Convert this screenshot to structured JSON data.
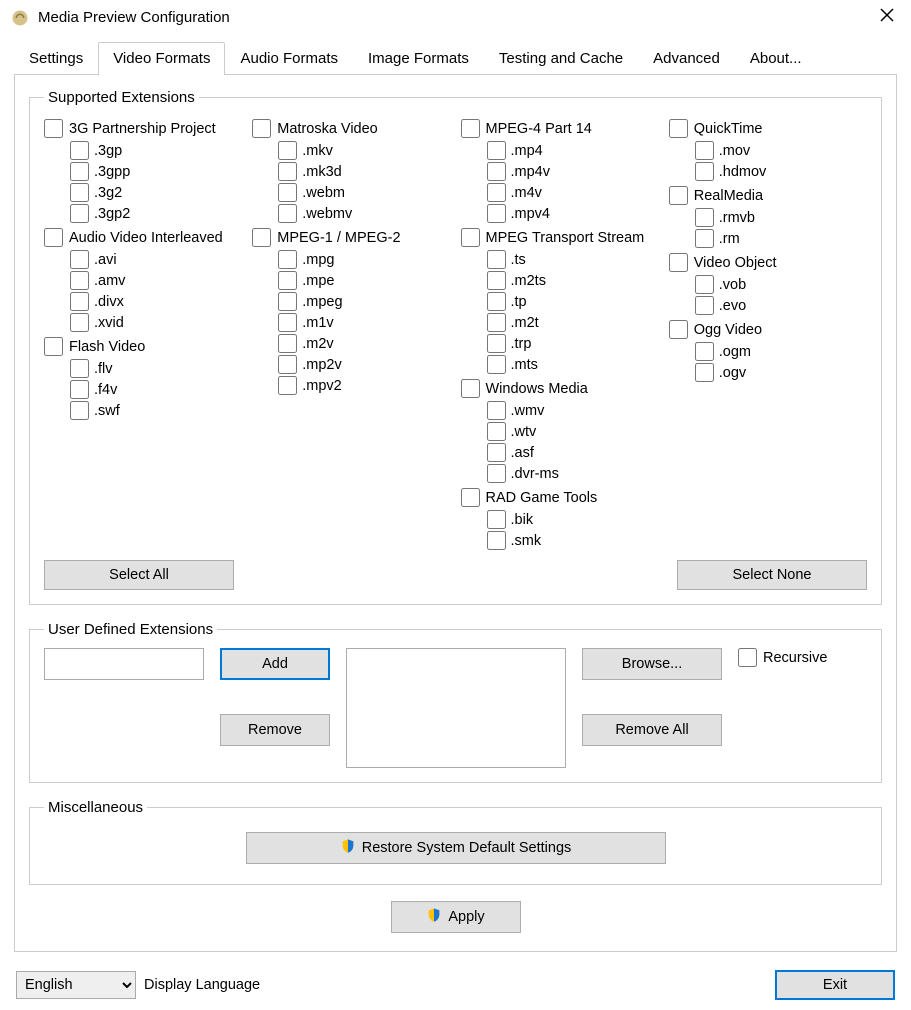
{
  "window": {
    "title": "Media Preview Configuration"
  },
  "tabs": [
    "Settings",
    "Video Formats",
    "Audio Formats",
    "Image Formats",
    "Testing and Cache",
    "Advanced",
    "About..."
  ],
  "active_tab": 1,
  "groupbox": {
    "supported": "Supported Extensions",
    "userdef": "User Defined Extensions",
    "misc": "Miscellaneous"
  },
  "buttons": {
    "select_all": "Select All",
    "select_none": "Select None",
    "add": "Add",
    "remove": "Remove",
    "browse": "Browse...",
    "remove_all": "Remove All",
    "restore": "Restore System Default Settings",
    "apply": "Apply",
    "exit": "Exit"
  },
  "labels": {
    "recursive": "Recursive",
    "display_language": "Display Language"
  },
  "language": {
    "value": "English"
  },
  "col1": {
    "g1": {
      "name": "3G Partnership Project",
      "ext": [
        ".3gp",
        ".3gpp",
        ".3g2",
        ".3gp2"
      ]
    },
    "g2": {
      "name": "Audio Video Interleaved",
      "ext_rows": [
        [
          ".avi"
        ],
        [
          ".amv"
        ],
        [
          ".divx",
          ".xvid"
        ]
      ]
    },
    "g3": {
      "name": "Flash Video",
      "ext_rows": [
        [
          ".flv"
        ],
        [
          ".f4v",
          ".swf"
        ]
      ]
    }
  },
  "col2": {
    "g1": {
      "name": "Matroska Video",
      "ext": [
        ".mkv",
        ".mk3d",
        ".webm",
        ".webmv"
      ]
    },
    "g2": {
      "name": "MPEG-1 / MPEG-2",
      "ext": [
        ".mpg",
        ".mpe",
        ".mpeg",
        ".m1v",
        ".m2v",
        ".mp2v",
        ".mpv2"
      ]
    }
  },
  "col3": {
    "g1": {
      "name": "MPEG-4 Part 14",
      "ext_rows": [
        [
          ".mp4",
          ".mp4v"
        ],
        [
          ".m4v",
          ".mpv4"
        ]
      ]
    },
    "g2": {
      "name": "MPEG Transport Stream",
      "ext_rows": [
        [
          ".ts",
          ".m2ts"
        ],
        [
          ".tp",
          ".m2t"
        ],
        [
          ".trp",
          ".mts"
        ]
      ]
    },
    "g3": {
      "name": "Windows Media",
      "ext_rows": [
        [
          ".wmv",
          ".wtv"
        ],
        [
          ".asf",
          ".dvr-ms"
        ]
      ]
    },
    "g4": {
      "name": "RAD Game Tools",
      "ext": [
        ".bik",
        ".smk"
      ]
    }
  },
  "col4": {
    "g1": {
      "name": "QuickTime",
      "ext": [
        ".mov",
        ".hdmov"
      ]
    },
    "g2": {
      "name": "RealMedia",
      "ext": [
        ".rmvb",
        ".rm"
      ]
    },
    "g3": {
      "name": "Video Object",
      "ext": [
        ".vob",
        ".evo"
      ]
    },
    "g4": {
      "name": "Ogg Video",
      "ext": [
        ".ogm",
        ".ogv"
      ]
    }
  }
}
